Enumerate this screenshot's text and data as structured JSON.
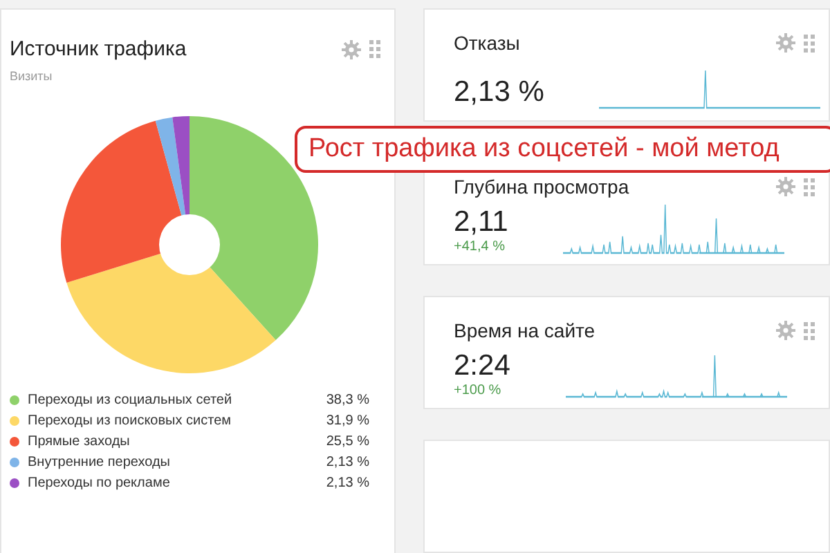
{
  "traffic_card": {
    "title": "Источник трафика",
    "subtitle": "Визиты",
    "chart_data": {
      "type": "donut",
      "values": [
        38.3,
        31.9,
        25.5,
        2.13,
        2.13
      ]
    },
    "legend": [
      {
        "label": "Переходы из социальных сетей",
        "value": "38,3 %",
        "color": "#8fd16a"
      },
      {
        "label": "Переходы из поисковых систем",
        "value": "31,9 %",
        "color": "#fdd866"
      },
      {
        "label": "Прямые заходы",
        "value": "25,5 %",
        "color": "#f4573a"
      },
      {
        "label": "Внутренние переходы",
        "value": "2,13 %",
        "color": "#7fb4e8"
      },
      {
        "label": "Переходы по рекламе",
        "value": "2,13 %",
        "color": "#9b4fc4"
      }
    ]
  },
  "metric_cards": [
    {
      "title": "Отказы",
      "value": "2,13 %"
    },
    {
      "title": "Глубина просмотра",
      "value": "2,11",
      "change": "+41,4 %"
    },
    {
      "title": "Время на сайте",
      "value": "2:24",
      "change": "+100 %"
    }
  ],
  "callout": "Рост трафика из соцсетей - мой метод"
}
